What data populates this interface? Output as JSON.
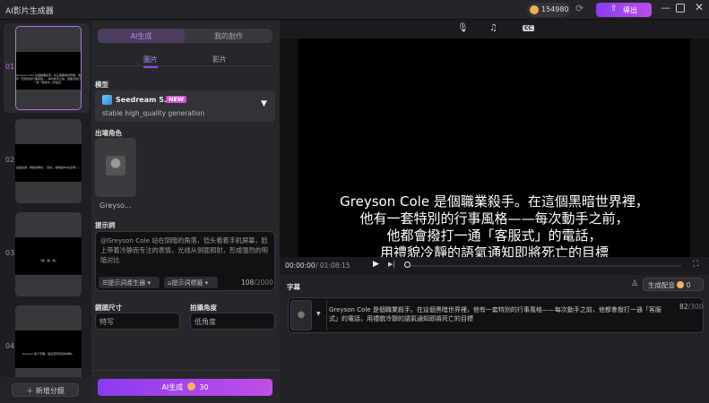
{
  "app": {
    "title": "AI影片生成器"
  },
  "header": {
    "credits": "154980",
    "export_label": "導出",
    "accent": "#9b44f0"
  },
  "scenes": [
    {
      "num": "01",
      "text": "Greyson Cole 是個職業殺手。在這個黑暗世界裡，他有一套特別的行事風格——每次動手之前，他都會撥打一通「客服式」的電話，"
    },
    {
      "num": "02",
      "text": "電話接通，禮貌的問候：「您好，請問是Bill先生嗎？」"
    },
    {
      "num": "03",
      "text": "「嘟，嘟，嘟」"
    },
    {
      "num": "04",
      "text": "Greyson 放下手機，露出若有所思的神情。"
    }
  ],
  "add_scene": "新增分鏡",
  "tabs": {
    "ai": "AI生成",
    "mine": "我的創作"
  },
  "subtabs": {
    "image": "圖片",
    "video": "影片"
  },
  "model": {
    "label": "模型",
    "name": "Seedream 5.0",
    "badge": "NEW",
    "desc": "stable high_quality generation"
  },
  "character": {
    "label": "出場角色",
    "name": "Greyso..."
  },
  "prompt": {
    "label": "提示詞",
    "value": "@Greyson Cole 站在阴暗的角落，低头看着手机屏幕，脸上带着冷静而专注的表情，光线从侧面照射，形成强烈的明暗对比",
    "generator": "提示詞產生器",
    "tags": "提示詞標籤",
    "count": "108",
    "max": "/2000"
  },
  "shot": {
    "label": "鏡頭尺寸",
    "value": "特写"
  },
  "angle": {
    "label": "拍攝角度",
    "value": "低角度"
  },
  "generate": {
    "label": "AI生成",
    "cost": "30"
  },
  "player": {
    "lines": [
      "Greyson Cole 是個職業殺手。在這個黑暗世界裡，",
      "他有一套特別的行事風格——每次動手之前，",
      "他都會撥打一通「客服式」的電話，",
      "用禮貌冷靜的語氣通知即將死亡的目標"
    ],
    "current": "00:00:00",
    "total": "/ 01:08:15",
    "progress": 0
  },
  "subtitles": {
    "label": "字幕",
    "voice_label": "生成配音",
    "voice_cost": "0",
    "text": "Greyson Cole 是個職業殺手。在這個黑暗世界裡，他有一套特別的行事風格——每次動手之前，他都會撥打一通「客服式」的電話，用禮貌冷靜的語氣通知即將死亡的目標",
    "count": "82",
    "max": "/300"
  }
}
